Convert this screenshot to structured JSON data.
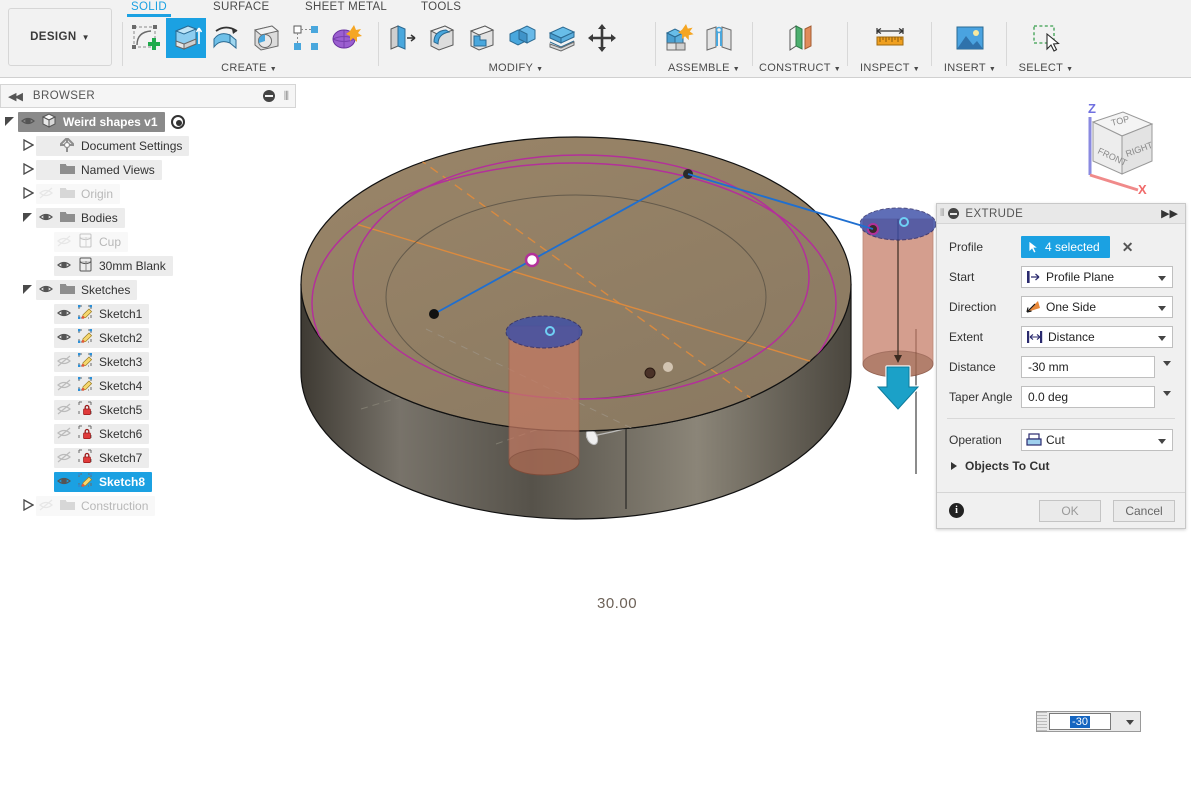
{
  "app": {
    "design_button": "DESIGN",
    "tabs": [
      {
        "label": "SOLID",
        "active": true
      },
      {
        "label": "SURFACE",
        "active": false
      },
      {
        "label": "SHEET METAL",
        "active": false
      },
      {
        "label": "TOOLS",
        "active": false
      }
    ],
    "panels": [
      {
        "label": "CREATE",
        "has_caret": true,
        "icons": [
          "new-sketch-icon",
          "extrude-icon",
          "revolve-icon",
          "sweep-icon",
          "pattern-icon",
          "form-icon"
        ]
      },
      {
        "label": "MODIFY",
        "has_caret": true,
        "icons": [
          "press-pull-icon",
          "fillet-icon",
          "shell-icon",
          "combine-icon",
          "offset-face-icon",
          "move-copy-icon"
        ]
      },
      {
        "label": "ASSEMBLE",
        "has_caret": true,
        "icons": [
          "new-component-icon",
          "joint-icon"
        ]
      },
      {
        "label": "CONSTRUCT",
        "has_caret": true,
        "icons": [
          "offset-plane-icon"
        ]
      },
      {
        "label": "INSPECT",
        "has_caret": true,
        "icons": [
          "measure-icon"
        ]
      },
      {
        "label": "INSERT",
        "has_caret": true,
        "icons": [
          "insert-image-icon"
        ]
      },
      {
        "label": "SELECT",
        "has_caret": true,
        "icons": [
          "select-window-icon"
        ]
      }
    ]
  },
  "browser": {
    "title": "BROWSER",
    "collapse_icon": "collapse-left-icon",
    "minimize_icon": "minimize-icon",
    "grip_icon": "resize-grip-icon",
    "tree": [
      {
        "label": "Weird shapes v1",
        "indent": 0,
        "arrow": "open",
        "eye": "visible",
        "icon": "component-icon",
        "state": "selected",
        "radio": true
      },
      {
        "label": "Document Settings",
        "indent": 1,
        "arrow": "closed",
        "eye": "none",
        "icon": "gear-icon",
        "state": "normal"
      },
      {
        "label": "Named Views",
        "indent": 1,
        "arrow": "closed",
        "eye": "none",
        "icon": "folder-icon",
        "state": "normal"
      },
      {
        "label": "Origin",
        "indent": 1,
        "arrow": "closed",
        "eye": "hidden",
        "icon": "folder-icon",
        "state": "dim"
      },
      {
        "label": "Bodies",
        "indent": 1,
        "arrow": "open",
        "eye": "visible",
        "icon": "folder-icon",
        "state": "normal"
      },
      {
        "label": "Cup",
        "indent": 2,
        "arrow": "none",
        "eye": "hidden",
        "icon": "body-icon",
        "state": "dim"
      },
      {
        "label": "30mm Blank",
        "indent": 2,
        "arrow": "none",
        "eye": "visible",
        "icon": "body-icon",
        "state": "normal"
      },
      {
        "label": "Sketches",
        "indent": 1,
        "arrow": "open",
        "eye": "visible",
        "icon": "folder-icon",
        "state": "normal"
      },
      {
        "label": "Sketch1",
        "indent": 2,
        "arrow": "none",
        "eye": "visible",
        "icon": "sketch-icon",
        "state": "normal"
      },
      {
        "label": "Sketch2",
        "indent": 2,
        "arrow": "none",
        "eye": "visible",
        "icon": "sketch-icon",
        "state": "normal"
      },
      {
        "label": "Sketch3",
        "indent": 2,
        "arrow": "none",
        "eye": "hidden",
        "icon": "sketch-icon",
        "state": "normal"
      },
      {
        "label": "Sketch4",
        "indent": 2,
        "arrow": "none",
        "eye": "hidden",
        "icon": "sketch-icon",
        "state": "normal"
      },
      {
        "label": "Sketch5",
        "indent": 2,
        "arrow": "none",
        "eye": "hidden",
        "icon": "sketch-locked-icon",
        "state": "normal"
      },
      {
        "label": "Sketch6",
        "indent": 2,
        "arrow": "none",
        "eye": "hidden",
        "icon": "sketch-locked-icon",
        "state": "normal"
      },
      {
        "label": "Sketch7",
        "indent": 2,
        "arrow": "none",
        "eye": "hidden",
        "icon": "sketch-locked-icon",
        "state": "normal"
      },
      {
        "label": "Sketch8",
        "indent": 2,
        "arrow": "none",
        "eye": "visible",
        "icon": "sketch-icon",
        "state": "active"
      },
      {
        "label": "Construction",
        "indent": 1,
        "arrow": "closed",
        "eye": "hidden",
        "icon": "folder-icon",
        "state": "dim"
      }
    ]
  },
  "extrude_dialog": {
    "title": "EXTRUDE",
    "expand_icon": "expand-right-icon",
    "minimize_icon": "minimize-icon",
    "profile_label": "Profile",
    "profile_value": "4 selected",
    "profile_clear_icon": "close-icon",
    "rows": [
      {
        "label": "Start",
        "value": "Profile Plane",
        "icon": "start-plane-icon",
        "type": "combo"
      },
      {
        "label": "Direction",
        "value": "One Side",
        "icon": "direction-one-side-icon",
        "type": "combo"
      },
      {
        "label": "Extent",
        "value": "Distance",
        "icon": "extent-distance-icon",
        "type": "combo"
      },
      {
        "label": "Distance",
        "value": "-30 mm",
        "icon": "",
        "type": "input"
      },
      {
        "label": "Taper Angle",
        "value": "0.0 deg",
        "icon": "",
        "type": "input"
      }
    ],
    "operation_label": "Operation",
    "operation_value": "Cut",
    "operation_icon": "cut-operation-icon",
    "objects_to_cut_label": "Objects To Cut",
    "info_icon": "info-icon",
    "ok_label": "OK",
    "cancel_label": "Cancel"
  },
  "canvas": {
    "viewcube": {
      "faces": [
        "TOP",
        "FRONT",
        "RIGHT"
      ],
      "axes": [
        {
          "label": "Z",
          "color": "#6a6ae8"
        },
        {
          "label": "X",
          "color": "#e86a6a"
        }
      ]
    },
    "dimension_text": "30.00",
    "manipulator_input_value": "-30",
    "manipulator_dropdown_icon": "chevron-down-icon",
    "drag_arrow_icon": "drag-down-arrow-icon",
    "colors": {
      "body_top": "#9a8568",
      "body_side": "#6b6657",
      "sketch_magenta": "#b3309a",
      "profile_preview": "#c47a63",
      "selected_blue": "#3d4fa8",
      "axis_orange": "#e08b3c",
      "line_blue": "#1f6fd0",
      "arrow_cyan": "#1ba1c8"
    }
  }
}
